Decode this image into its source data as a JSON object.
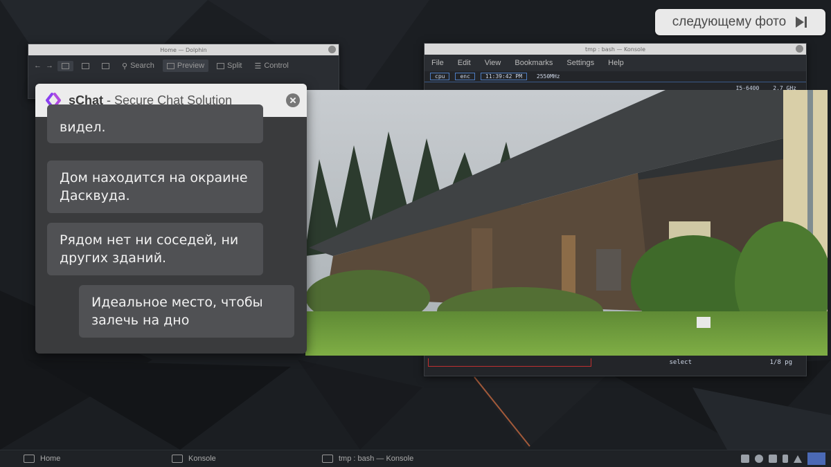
{
  "next_button": {
    "label": "следующему фото",
    "icon": "skip-next-icon"
  },
  "file_manager": {
    "title": "Home — Dolphin",
    "toolbar": [
      {
        "label": "Search",
        "icon": "search-icon"
      },
      {
        "label": "Preview",
        "icon": "preview-icon"
      },
      {
        "label": "Split",
        "icon": "split-icon"
      },
      {
        "label": "Control",
        "icon": "menu-icon"
      }
    ]
  },
  "konsole": {
    "title": "tmp : bash — Konsole",
    "menu": [
      "File",
      "Edit",
      "View",
      "Bookmarks",
      "Settings",
      "Help"
    ],
    "status": {
      "cpu": "cpu",
      "enc": "enc",
      "time": "11:39:42 PM",
      "freq1": "2550MHz",
      "freq2": "2.7 GHz",
      "cpu_id": "I5-6400"
    },
    "bottom": {
      "select": "select",
      "pages": "1/8 pg"
    }
  },
  "chat": {
    "app_name": "sChat",
    "subtitle": "Secure Chat Solution",
    "messages": [
      {
        "text": "видел.",
        "direction": "in"
      },
      {
        "text": "Дом находится на окраине Дасквуда.",
        "direction": "in"
      },
      {
        "text": "Рядом нет ни соседей, ни других зданий.",
        "direction": "in"
      },
      {
        "text": "Идеальное место, чтобы залечь на дно",
        "direction": "out"
      }
    ]
  },
  "photo": {
    "subject": "abandoned-barn-photo"
  },
  "taskbar": {
    "tasks": [
      {
        "label": "Home",
        "icon": "folder-icon"
      },
      {
        "label": "Konsole",
        "icon": "terminal-icon"
      },
      {
        "label": "tmp : bash — Konsole",
        "icon": "terminal-icon"
      }
    ],
    "tray_icons": [
      "clipboard-icon",
      "download-icon",
      "display-icon",
      "volume-icon",
      "notifications-icon"
    ]
  },
  "colors": {
    "chat_header": "#ececec",
    "chat_bg": "#3a3b3d",
    "bubble": "#505154",
    "accent": "#7b3fe4"
  }
}
